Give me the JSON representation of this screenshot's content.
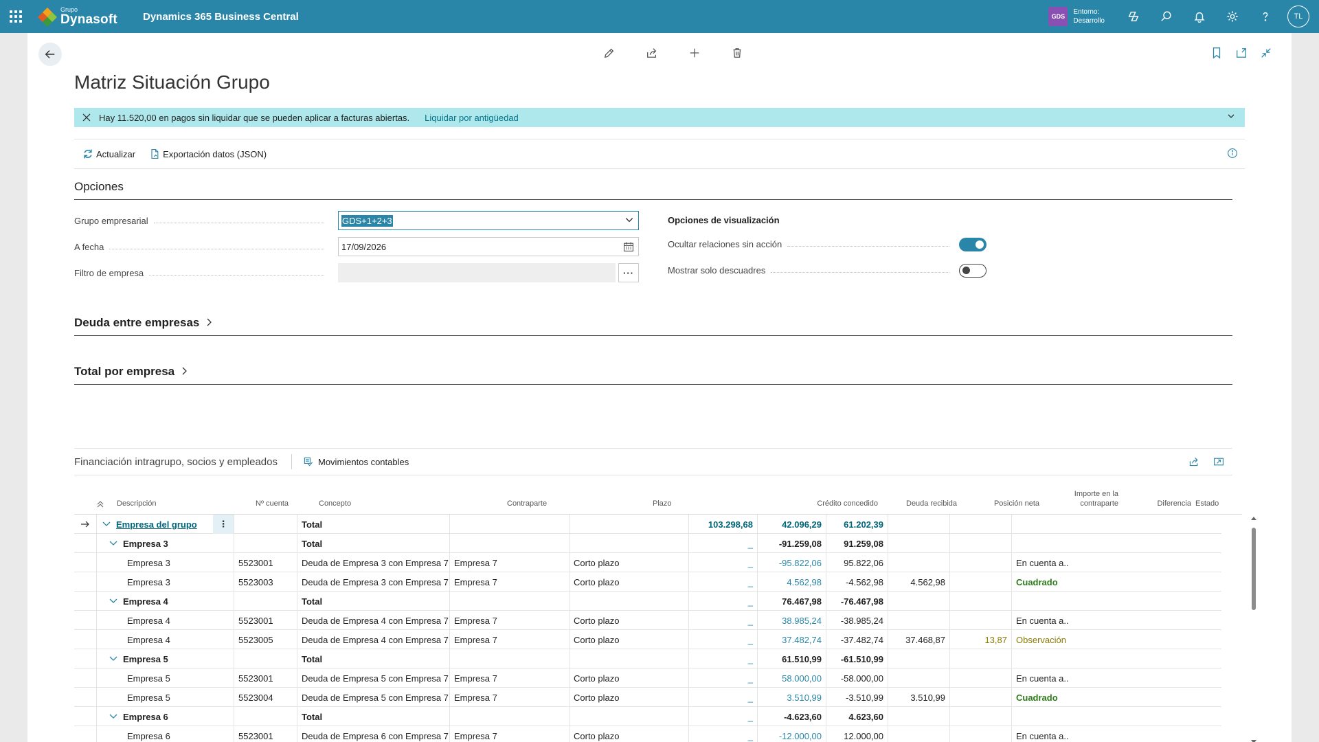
{
  "topbar": {
    "brand_small": "Grupo",
    "brand_name": "Dynasoft",
    "product": "Dynamics 365 Business Central",
    "env_badge": "GDS",
    "env_line1": "Entorno:",
    "env_line2": "Desarrollo",
    "avatar": "TL",
    "icons": [
      "copilot-icon",
      "search-icon",
      "bell-icon",
      "gear-icon",
      "help-icon"
    ]
  },
  "page": {
    "title": "Matriz Situación Grupo",
    "toolbar_icons": [
      "edit-icon",
      "share-icon",
      "new-icon",
      "delete-icon"
    ],
    "right_icons": [
      "bookmark-icon",
      "open-new-window-icon",
      "collapse-icon"
    ]
  },
  "notification": {
    "message": "Hay 11.520,00 en pagos sin liquidar que se pueden aplicar a facturas abiertas.",
    "link": "Liquidar por antigüedad"
  },
  "actions": {
    "refresh": "Actualizar",
    "export": "Exportación datos (JSON)"
  },
  "options": {
    "section_title": "Opciones",
    "group_label": "Grupo empresarial",
    "group_value": "GDS+1+2+3",
    "date_label": "A fecha",
    "date_value": "17/09/2026",
    "filter_label": "Filtro de empresa",
    "filter_value": "",
    "ellipsis": "···",
    "vis_title": "Opciones de visualización",
    "hide_label": "Ocultar relaciones sin acción",
    "hide_on": true,
    "only_label": "Mostrar solo descuadres",
    "only_on": false
  },
  "sections": {
    "debt": "Deuda entre empresas",
    "total": "Total por empresa"
  },
  "subpage": {
    "title": "Financiación intragrupo, socios y empleados",
    "action": "Movimientos contables"
  },
  "table": {
    "headers": {
      "desc": "Descripción",
      "account": "Nº cuenta",
      "concept": "Concepto",
      "counterpart": "Contraparte",
      "term": "Plazo",
      "credit": "Crédito concedido",
      "debt": "Deuda recibida",
      "net": "Posición neta",
      "cp_amount_1": "Importe en la",
      "cp_amount_2": "contraparte",
      "diff": "Diferencia",
      "status": "Estado"
    },
    "rows": [
      {
        "level": 0,
        "desc": "Empresa del grupo",
        "account": "",
        "concept": "Total",
        "counterpart": "",
        "term": "",
        "credit": "103.298,68",
        "debt": "42.096,29",
        "net": "61.202,39",
        "cp": "",
        "diff": "",
        "status": "",
        "status_type": ""
      },
      {
        "level": 1,
        "desc": "Empresa 3",
        "account": "",
        "concept": "Total",
        "counterpart": "",
        "term": "",
        "credit": "_",
        "debt": "-91.259,08",
        "net": "91.259,08",
        "cp": "",
        "diff": "",
        "status": "",
        "status_type": ""
      },
      {
        "level": 2,
        "desc": "Empresa 3",
        "account": "5523001",
        "concept": "Deuda de Empresa 3 con Empresa 7",
        "counterpart": "Empresa 7",
        "term": "Corto plazo",
        "credit": "_",
        "debt": "-95.822,06",
        "net": "95.822,06",
        "cp": "",
        "diff": "",
        "status": "En cuenta a...",
        "status_type": "plain"
      },
      {
        "level": 2,
        "desc": "Empresa 3",
        "account": "5523003",
        "concept": "Deuda de Empresa 3 con Empresa 7",
        "counterpart": "Empresa 7",
        "term": "Corto plazo",
        "credit": "_",
        "debt": "4.562,98",
        "net": "-4.562,98",
        "cp": "4.562,98",
        "diff": "",
        "status": "Cuadrado",
        "status_type": "ok"
      },
      {
        "level": 1,
        "desc": "Empresa 4",
        "account": "",
        "concept": "Total",
        "counterpart": "",
        "term": "",
        "credit": "_",
        "debt": "76.467,98",
        "net": "-76.467,98",
        "cp": "",
        "diff": "",
        "status": "",
        "status_type": ""
      },
      {
        "level": 2,
        "desc": "Empresa 4",
        "account": "5523001",
        "concept": "Deuda de Empresa 4 con Empresa 7",
        "counterpart": "Empresa 7",
        "term": "Corto plazo",
        "credit": "_",
        "debt": "38.985,24",
        "net": "-38.985,24",
        "cp": "",
        "diff": "",
        "status": "En cuenta a...",
        "status_type": "plain"
      },
      {
        "level": 2,
        "desc": "Empresa 4",
        "account": "5523005",
        "concept": "Deuda de Empresa 4 con Empresa 7",
        "counterpart": "Empresa 7",
        "term": "Corto plazo",
        "credit": "_",
        "debt": "37.482,74",
        "net": "-37.482,74",
        "cp": "37.468,87",
        "diff": "13,87",
        "status": "Observación",
        "status_type": "warn"
      },
      {
        "level": 1,
        "desc": "Empresa 5",
        "account": "",
        "concept": "Total",
        "counterpart": "",
        "term": "",
        "credit": "_",
        "debt": "61.510,99",
        "net": "-61.510,99",
        "cp": "",
        "diff": "",
        "status": "",
        "status_type": ""
      },
      {
        "level": 2,
        "desc": "Empresa 5",
        "account": "5523001",
        "concept": "Deuda de Empresa 5 con Empresa 7",
        "counterpart": "Empresa 7",
        "term": "Corto plazo",
        "credit": "_",
        "debt": "58.000,00",
        "net": "-58.000,00",
        "cp": "",
        "diff": "",
        "status": "En cuenta a...",
        "status_type": "plain"
      },
      {
        "level": 2,
        "desc": "Empresa 5",
        "account": "5523004",
        "concept": "Deuda de Empresa 5 con Empresa 7",
        "counterpart": "Empresa 7",
        "term": "Corto plazo",
        "credit": "_",
        "debt": "3.510,99",
        "net": "-3.510,99",
        "cp": "3.510,99",
        "diff": "",
        "status": "Cuadrado",
        "status_type": "ok"
      },
      {
        "level": 1,
        "desc": "Empresa 6",
        "account": "",
        "concept": "Total",
        "counterpart": "",
        "term": "",
        "credit": "_",
        "debt": "-4.623,60",
        "net": "4.623,60",
        "cp": "",
        "diff": "",
        "status": "",
        "status_type": ""
      },
      {
        "level": 2,
        "desc": "Empresa 6",
        "account": "5523001",
        "concept": "Deuda de Empresa 6 con Empresa 7",
        "counterpart": "Empresa 7",
        "term": "Corto plazo",
        "credit": "_",
        "debt": "-12.000,00",
        "net": "12.000,00",
        "cp": "",
        "diff": "",
        "status": "En cuenta a...",
        "status_type": "plain"
      }
    ]
  },
  "colors": {
    "accent": "#2a86a8",
    "notification_bg": "#aee8ec",
    "ok": "#2e7d1a",
    "warn": "#8a7a00",
    "env_badge": "#8a4fb3"
  }
}
